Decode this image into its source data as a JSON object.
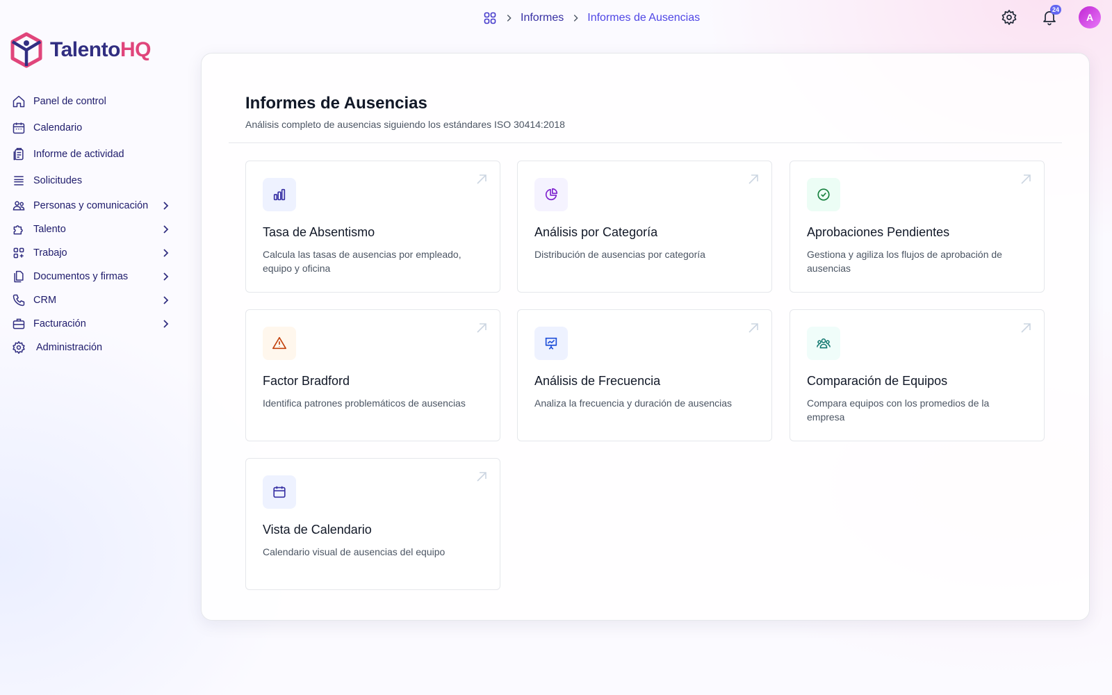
{
  "brand": {
    "name_part1": "Talento",
    "name_part2": "HQ",
    "accent": "#e0457b",
    "primary": "#312e81"
  },
  "breadcrumb": {
    "home_icon": "grid-icon",
    "items": [
      "Informes",
      "Informes de Ausencias"
    ]
  },
  "topbar": {
    "settings_icon": "gear-icon",
    "notifications_icon": "bell-icon",
    "notifications_count": "24",
    "avatar_initial": "A"
  },
  "sidebar": {
    "items": [
      {
        "label": "Panel de control",
        "icon": "home-icon",
        "expandable": false
      },
      {
        "label": "Calendario",
        "icon": "calendar-icon",
        "expandable": false
      },
      {
        "label": "Informe de actividad",
        "icon": "report-icon",
        "expandable": false
      },
      {
        "label": "Solicitudes",
        "icon": "list-icon",
        "expandable": false
      },
      {
        "label": "Personas y comunicación",
        "icon": "people-icon",
        "expandable": true
      },
      {
        "label": "Talento",
        "icon": "puzzle-icon",
        "expandable": true
      },
      {
        "label": "Trabajo",
        "icon": "apps-icon",
        "expandable": true
      },
      {
        "label": "Documentos y firmas",
        "icon": "documents-icon",
        "expandable": true
      },
      {
        "label": "CRM",
        "icon": "phone-icon",
        "expandable": true
      },
      {
        "label": "Facturación",
        "icon": "briefcase-icon",
        "expandable": true
      },
      {
        "label": "Administración",
        "icon": "gear-icon",
        "expandable": false
      }
    ]
  },
  "main": {
    "title": "Informes de Ausencias",
    "subtitle": "Análisis completo de ausencias siguiendo los estándares ISO 30414:2018",
    "cards": [
      {
        "title": "Tasa de Absentismo",
        "description": "Calcula las tasas de ausencias por empleado, equipo y oficina",
        "icon": "bar-chart-icon",
        "color": "#3730a3"
      },
      {
        "title": "Análisis por Categoría",
        "description": "Distribución de ausencias por categoría",
        "icon": "pie-chart-icon",
        "color": "#7e22ce"
      },
      {
        "title": "Aprobaciones Pendientes",
        "description": "Gestiona y agiliza los flujos de aprobación de ausencias",
        "icon": "check-circle-icon",
        "color": "#15803d"
      },
      {
        "title": "Factor Bradford",
        "description": "Identifica patrones problemáticos de ausencias",
        "icon": "warning-icon",
        "color": "#c2410c"
      },
      {
        "title": "Análisis de Frecuencia",
        "description": "Analiza la frecuencia y duración de ausencias",
        "icon": "presentation-chart-icon",
        "color": "#1d4ed8"
      },
      {
        "title": "Comparación de Equipos",
        "description": "Compara equipos con los promedios de la empresa",
        "icon": "team-icon",
        "color": "#0f766e"
      },
      {
        "title": "Vista de Calendario",
        "description": "Calendario visual de ausencias del equipo",
        "icon": "calendar-icon",
        "color": "#3730a3"
      }
    ]
  }
}
